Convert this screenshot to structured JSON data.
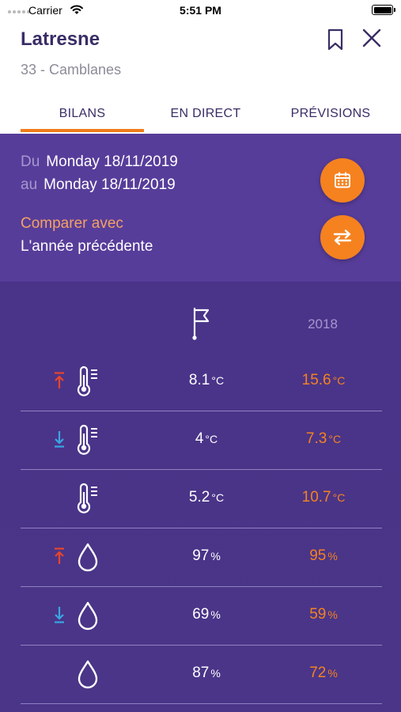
{
  "status_bar": {
    "carrier": "Carrier",
    "time": "5:51 PM"
  },
  "header": {
    "title": "Latresne",
    "subtitle": "33 - Camblanes"
  },
  "tabs": [
    {
      "label": "BILANS",
      "active": true
    },
    {
      "label": "EN DIRECT",
      "active": false
    },
    {
      "label": "PRÉVISIONS",
      "active": false
    }
  ],
  "period": {
    "du_label": "Du",
    "du_value": "Monday 18/11/2019",
    "au_label": "au",
    "au_value": "Monday 18/11/2019"
  },
  "compare": {
    "label": "Comparer avec",
    "value": "L'année précédente"
  },
  "table": {
    "compare_year": "2018",
    "rows": [
      {
        "arrow": "up",
        "icon": "thermometer-icon",
        "value": "8.1",
        "unit": "°C",
        "compare": "15.6",
        "compare_unit": "°C"
      },
      {
        "arrow": "down",
        "icon": "thermometer-icon",
        "value": "4",
        "unit": "°C",
        "compare": "7.3",
        "compare_unit": "°C"
      },
      {
        "arrow": "none",
        "icon": "thermometer-icon",
        "value": "5.2",
        "unit": "°C",
        "compare": "10.7",
        "compare_unit": "°C"
      },
      {
        "arrow": "up",
        "icon": "drop-icon",
        "value": "97",
        "unit": "%",
        "compare": "95",
        "compare_unit": "%"
      },
      {
        "arrow": "down",
        "icon": "drop-icon",
        "value": "69",
        "unit": "%",
        "compare": "59",
        "compare_unit": "%"
      },
      {
        "arrow": "none",
        "icon": "drop-icon",
        "value": "87",
        "unit": "%",
        "compare": "72",
        "compare_unit": "%"
      }
    ]
  },
  "colors": {
    "accent": "#f5821f",
    "primary": "#3a2d66",
    "panel": "#4a3589",
    "arrow_up": "#e8452c",
    "arrow_down": "#3aa6e2"
  }
}
